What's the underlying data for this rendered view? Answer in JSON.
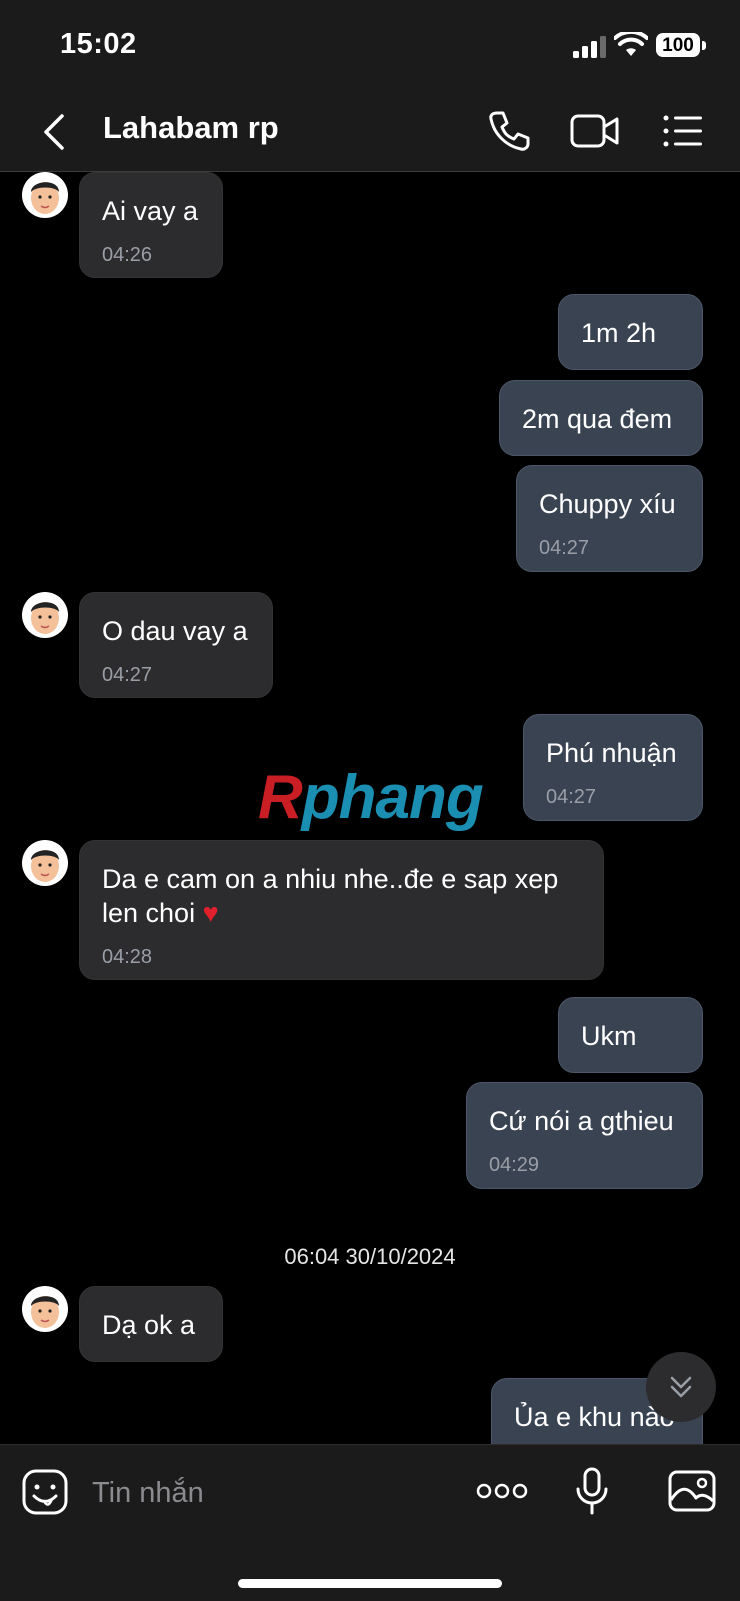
{
  "status_bar": {
    "time": "15:02",
    "battery": "100"
  },
  "header": {
    "contact_name": "Lahabam rp"
  },
  "messages": [
    {
      "text": "Ai vay a",
      "time": "04:26"
    },
    {
      "text": "1m 2h"
    },
    {
      "text": "2m qua đem"
    },
    {
      "text": "Chuppy xíu",
      "time": "04:27"
    },
    {
      "text": "O dau vay a",
      "time": "04:27"
    },
    {
      "text": "Phú nhuận",
      "time": "04:27"
    },
    {
      "text_line1": "Da e cam on a nhiu nhe..đe e sap xep",
      "text_line2": "len choi",
      "emoji": "♥",
      "time": "04:28"
    },
    {
      "text": "Ukm"
    },
    {
      "text": "Cứ nói a gthieu",
      "time": "04:29"
    },
    {
      "text": "Dạ ok a"
    },
    {
      "text": "Ủa e khu nào"
    }
  ],
  "day_separator": "06:04 30/10/2024",
  "watermark": {
    "first": "R",
    "rest": "phang"
  },
  "composer": {
    "placeholder": "Tin nhắn"
  },
  "colors": {
    "incoming_bubble": "#2c2c2e",
    "outgoing_bubble": "#3a4352",
    "background": "#000000",
    "bar": "#1b1b1b"
  }
}
